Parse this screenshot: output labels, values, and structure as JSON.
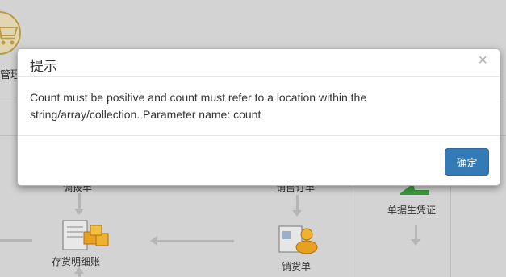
{
  "background": {
    "module_label": "管理",
    "nodes": {
      "transfer_order": "调拨单",
      "inventory_detail": "存货明细账",
      "sales_order": "销售订单",
      "sales_bill": "销货单",
      "voucher_gen": "单据生凭证"
    }
  },
  "dialog": {
    "title": "提示",
    "close_symbol": "×",
    "message_line1": "Count must be positive and count must refer to a location within the",
    "message_line2": "string/array/collection. Parameter name: count",
    "confirm_label": "确定"
  },
  "colors": {
    "primary_button": "#337ab7",
    "overlay": "#d3d3d3"
  }
}
